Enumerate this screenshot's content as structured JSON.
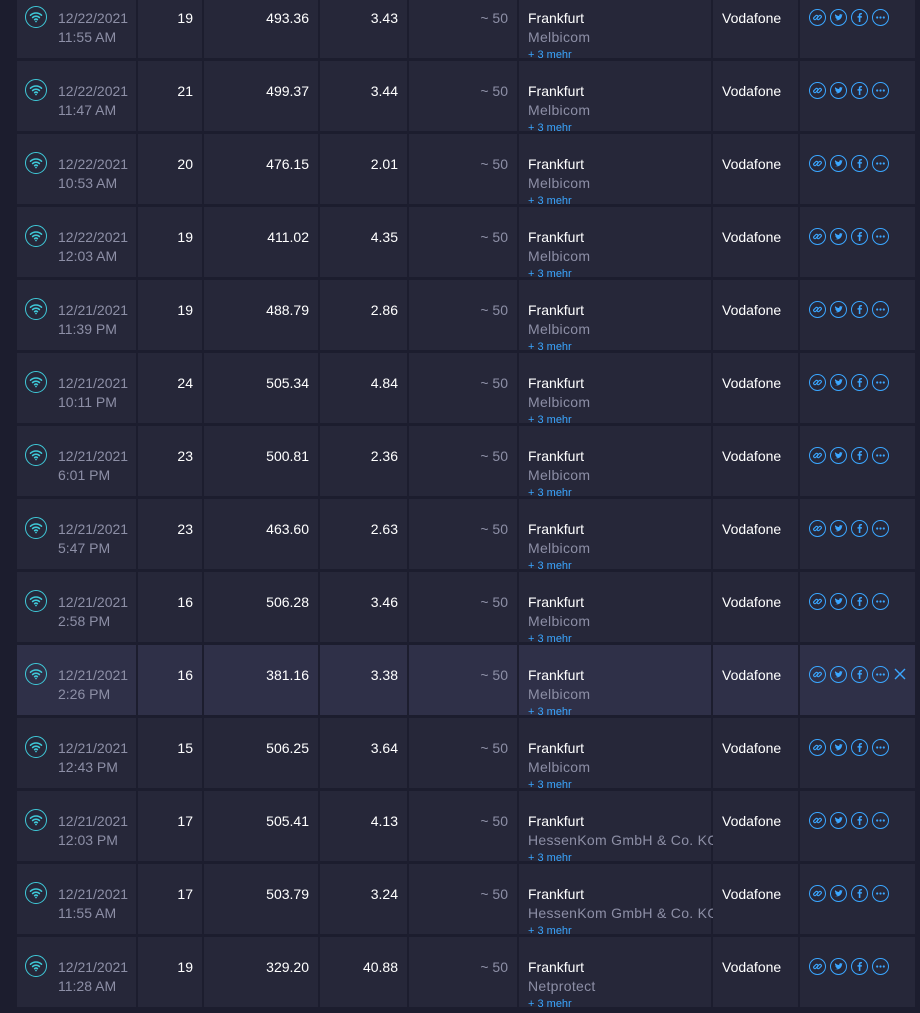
{
  "theme": {
    "background": "#1c1d2e",
    "row_bg": "#262739",
    "row_highlight_bg": "#2f3048",
    "accent": "#3aa6ff",
    "wifi_icon": "#3fc9d8",
    "muted_text": "#8d8fa6"
  },
  "icons": {
    "connection": "wifi-icon",
    "actions": [
      "link-icon",
      "twitter-icon",
      "facebook-icon",
      "more-icon"
    ],
    "close": "close-icon"
  },
  "results": [
    {
      "date": "12/22/2021",
      "time": "11:55 AM",
      "ping": "19",
      "download": "493.36",
      "upload": "3.43",
      "distance": "~ 50",
      "city": "Frankfurt",
      "sponsor": "Melbicom",
      "more": "+ 3 mehr",
      "isp": "Vodafone"
    },
    {
      "date": "12/22/2021",
      "time": "11:47 AM",
      "ping": "21",
      "download": "499.37",
      "upload": "3.44",
      "distance": "~ 50",
      "city": "Frankfurt",
      "sponsor": "Melbicom",
      "more": "+ 3 mehr",
      "isp": "Vodafone"
    },
    {
      "date": "12/22/2021",
      "time": "10:53 AM",
      "ping": "20",
      "download": "476.15",
      "upload": "2.01",
      "distance": "~ 50",
      "city": "Frankfurt",
      "sponsor": "Melbicom",
      "more": "+ 3 mehr",
      "isp": "Vodafone"
    },
    {
      "date": "12/22/2021",
      "time": "12:03 AM",
      "ping": "19",
      "download": "411.02",
      "upload": "4.35",
      "distance": "~ 50",
      "city": "Frankfurt",
      "sponsor": "Melbicom",
      "more": "+ 3 mehr",
      "isp": "Vodafone"
    },
    {
      "date": "12/21/2021",
      "time": "11:39 PM",
      "ping": "19",
      "download": "488.79",
      "upload": "2.86",
      "distance": "~ 50",
      "city": "Frankfurt",
      "sponsor": "Melbicom",
      "more": "+ 3 mehr",
      "isp": "Vodafone"
    },
    {
      "date": "12/21/2021",
      "time": "10:11 PM",
      "ping": "24",
      "download": "505.34",
      "upload": "4.84",
      "distance": "~ 50",
      "city": "Frankfurt",
      "sponsor": "Melbicom",
      "more": "+ 3 mehr",
      "isp": "Vodafone"
    },
    {
      "date": "12/21/2021",
      "time": "6:01 PM",
      "ping": "23",
      "download": "500.81",
      "upload": "2.36",
      "distance": "~ 50",
      "city": "Frankfurt",
      "sponsor": "Melbicom",
      "more": "+ 3 mehr",
      "isp": "Vodafone"
    },
    {
      "date": "12/21/2021",
      "time": "5:47 PM",
      "ping": "23",
      "download": "463.60",
      "upload": "2.63",
      "distance": "~ 50",
      "city": "Frankfurt",
      "sponsor": "Melbicom",
      "more": "+ 3 mehr",
      "isp": "Vodafone"
    },
    {
      "date": "12/21/2021",
      "time": "2:58 PM",
      "ping": "16",
      "download": "506.28",
      "upload": "3.46",
      "distance": "~ 50",
      "city": "Frankfurt",
      "sponsor": "Melbicom",
      "more": "+ 3 mehr",
      "isp": "Vodafone"
    },
    {
      "date": "12/21/2021",
      "time": "2:26 PM",
      "ping": "16",
      "download": "381.16",
      "upload": "3.38",
      "distance": "~ 50",
      "city": "Frankfurt",
      "sponsor": "Melbicom",
      "more": "+ 3 mehr",
      "isp": "Vodafone",
      "highlighted": true
    },
    {
      "date": "12/21/2021",
      "time": "12:43 PM",
      "ping": "15",
      "download": "506.25",
      "upload": "3.64",
      "distance": "~ 50",
      "city": "Frankfurt",
      "sponsor": "Melbicom",
      "more": "+ 3 mehr",
      "isp": "Vodafone"
    },
    {
      "date": "12/21/2021",
      "time": "12:03 PM",
      "ping": "17",
      "download": "505.41",
      "upload": "4.13",
      "distance": "~ 50",
      "city": "Frankfurt",
      "sponsor": "HessenKom GmbH & Co. KG",
      "more": "+ 3 mehr",
      "isp": "Vodafone"
    },
    {
      "date": "12/21/2021",
      "time": "11:55 AM",
      "ping": "17",
      "download": "503.79",
      "upload": "3.24",
      "distance": "~ 50",
      "city": "Frankfurt",
      "sponsor": "HessenKom GmbH & Co. KG",
      "more": "+ 3 mehr",
      "isp": "Vodafone"
    },
    {
      "date": "12/21/2021",
      "time": "11:28 AM",
      "ping": "19",
      "download": "329.20",
      "upload": "40.88",
      "distance": "~ 50",
      "city": "Frankfurt",
      "sponsor": "Netprotect",
      "more": "+ 3 mehr",
      "isp": "Vodafone"
    }
  ]
}
